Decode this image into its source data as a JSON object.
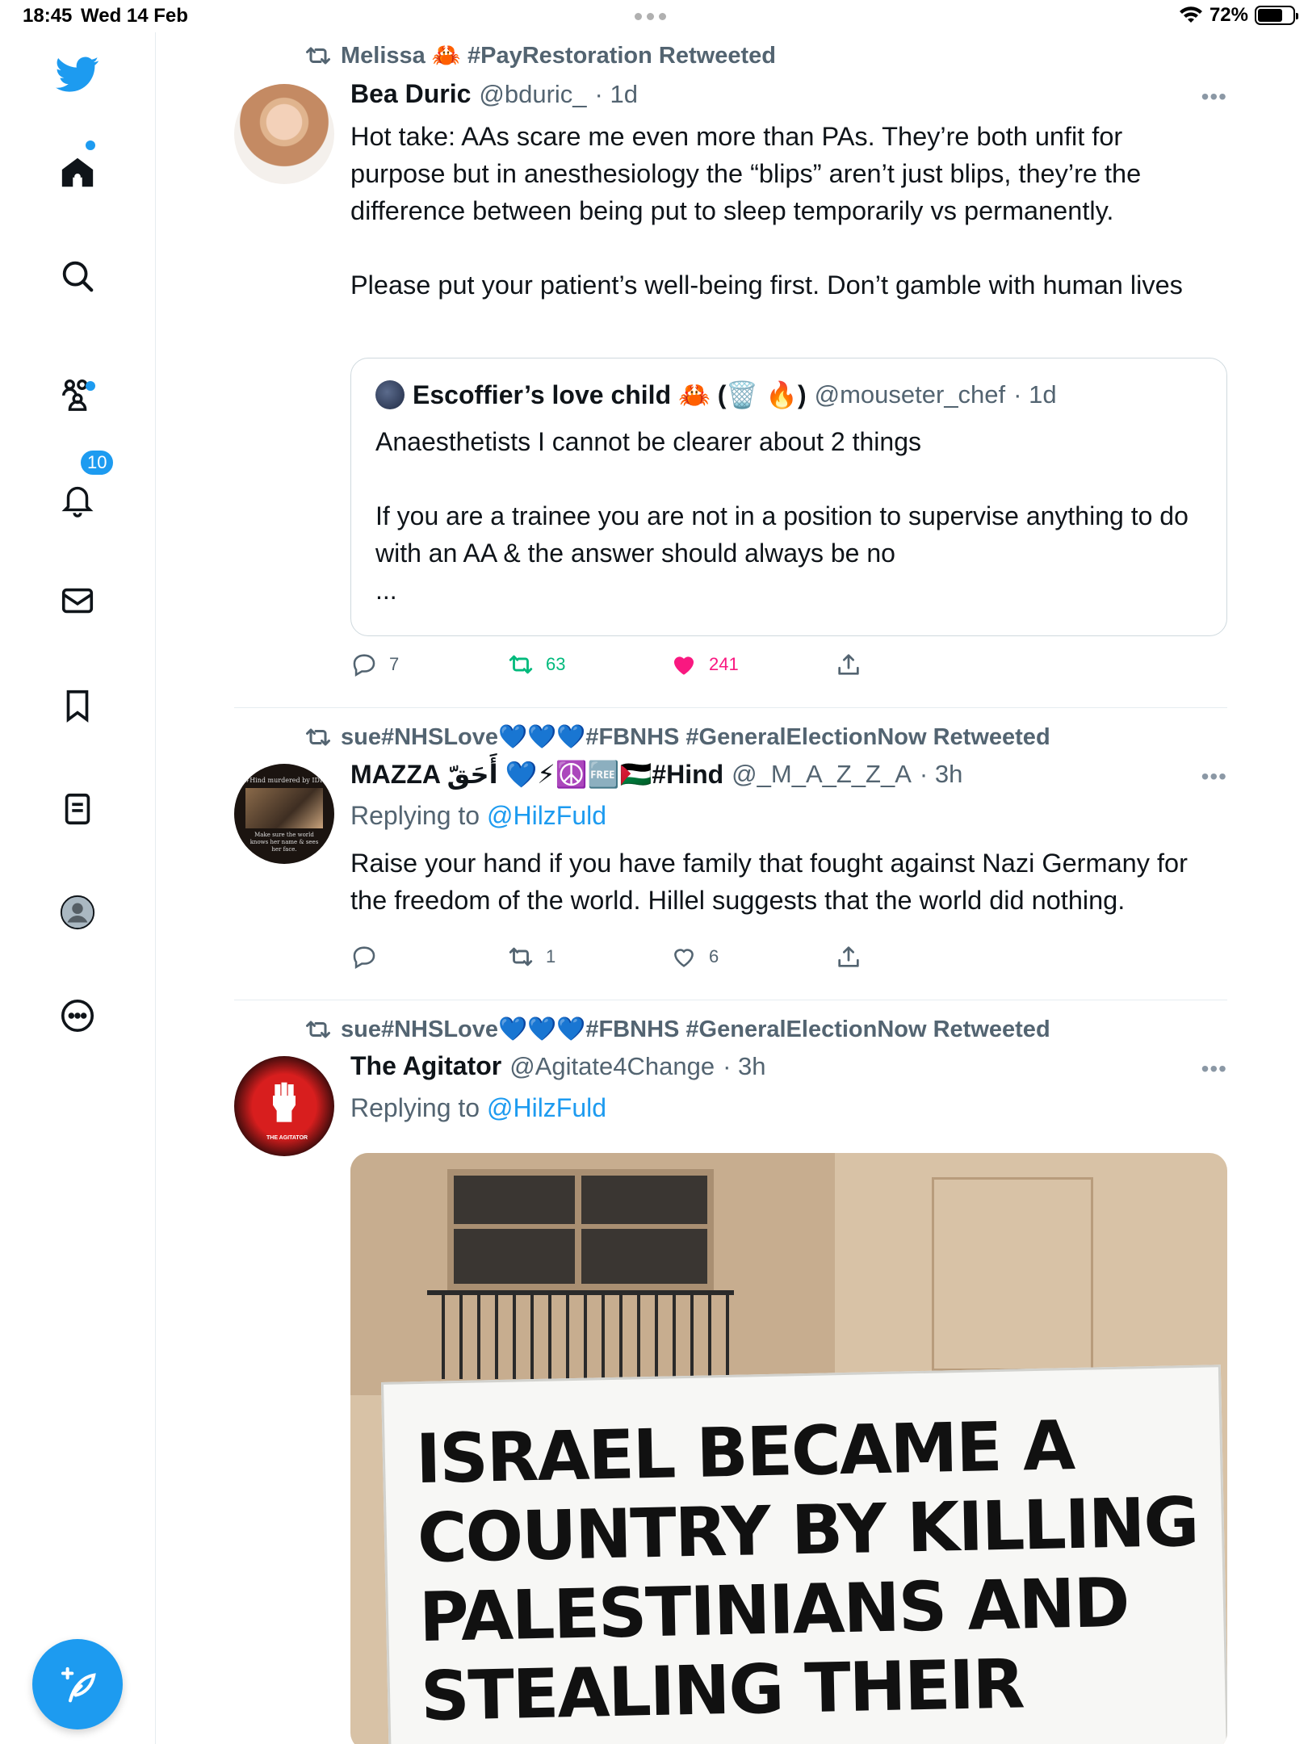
{
  "status_bar": {
    "time": "18:45",
    "date": "Wed 14 Feb",
    "battery": "72%"
  },
  "sidebar": {
    "notifications_count": "10",
    "items": [
      {
        "icon": "twitter-bird-icon"
      },
      {
        "icon": "home-icon"
      },
      {
        "icon": "search-icon"
      },
      {
        "icon": "communities-icon"
      },
      {
        "icon": "bell-icon"
      },
      {
        "icon": "mail-icon"
      },
      {
        "icon": "bookmark-icon"
      },
      {
        "icon": "lists-icon"
      },
      {
        "icon": "profile-icon"
      },
      {
        "icon": "more-icon"
      }
    ],
    "compose_icon": "compose-icon"
  },
  "colors": {
    "accent": "#1d9bf0",
    "retweet": "#00ba7c",
    "like": "#f91880",
    "muted": "#536471"
  },
  "tweets": [
    {
      "retweeted_by": "Melissa 🦀 #PayRestoration Retweeted",
      "name": "Bea Duric",
      "handle": "@bduric_",
      "time": "· 1d",
      "text_p1": "Hot take: AAs scare me even more than PAs. They’re both unfit for purpose but in anesthesiology the “blips” aren’t just blips, they’re the difference between being put to sleep temporarily vs permanently.",
      "text_p2": "Please put your patient’s well-being first. Don’t gamble with human lives",
      "quote": {
        "name": "Escoffier’s love child 🦀 (🗑️ 🔥)",
        "handle": "@mouseter_chef",
        "time": "· 1d",
        "text_p1": "Anaesthetists I cannot be clearer about 2 things",
        "text_p2": "If you are a trainee you are not in a position to supervise anything to do with an AA & the answer should always be no",
        "text_p3": "..."
      },
      "replies": "7",
      "retweets": "63",
      "likes": "241",
      "liked": true,
      "retweeted": true
    },
    {
      "retweeted_by": "sue#NHSLove💙💙💙#FBNHS #GeneralElectionNow Retweeted",
      "name": "MAZZA أَحَقّ 💙⚡☮️🆓🇵🇸#Hind",
      "handle": "@_M_A_Z_Z_A",
      "time": "· 3h",
      "replying_prefix": "Replying to",
      "replying_to": "@HilzFuld",
      "text": "Raise your hand if you have family that fought against Nazi Germany for the freedom of the world. Hillel suggests that the world did nothing.",
      "avatar_caption_top": "#Hind murdered by IDF",
      "avatar_caption_bottom": "Make sure the world knows her name & sees her face.",
      "replies": "",
      "retweets": "1",
      "likes": "6"
    },
    {
      "retweeted_by": "sue#NHSLove💙💙💙#FBNHS #GeneralElectionNow Retweeted",
      "name": "The Agitator",
      "handle": "@Agitate4Change",
      "time": "· 3h",
      "replying_prefix": "Replying to",
      "replying_to": "@HilzFuld",
      "avatar_caption": "THE AGITATOR",
      "image_text": "ISRAEL BECAME A COUNTRY BY KILLING PALESTINIANS AND STEALING THEIR LAND."
    }
  ]
}
